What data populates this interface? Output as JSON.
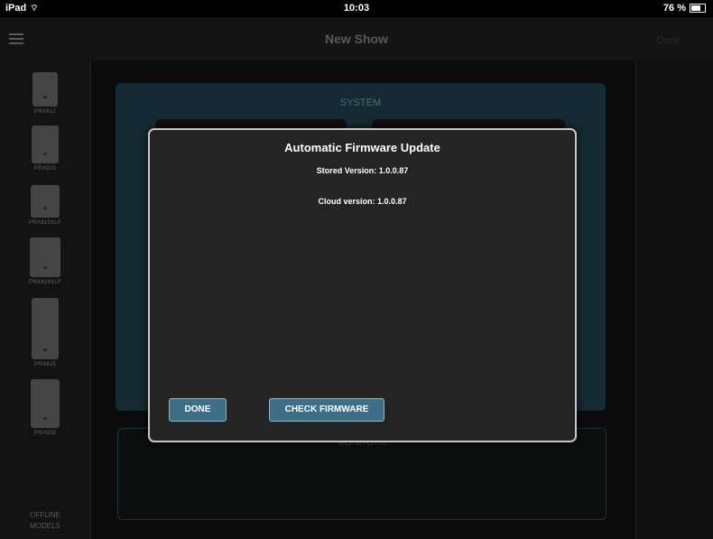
{
  "status_bar": {
    "device": "iPad",
    "time": "10:03",
    "battery": "76 %",
    "battery_level": 0.76
  },
  "nav": {
    "title": "New Show",
    "done_label": "Done"
  },
  "sidebar": {
    "speakers": [
      {
        "label": "PRX812"
      },
      {
        "label": "PRX815"
      },
      {
        "label": "PRX815XLF"
      },
      {
        "label": "PRX818XLF"
      },
      {
        "label": "PRX825"
      },
      {
        "label": "PRX835"
      }
    ],
    "offline_line1": "OFFLINE",
    "offline_line2": "MODELS"
  },
  "background": {
    "system_label": "SYSTEM",
    "monitors_label": "MONITORS"
  },
  "modal": {
    "title": "Automatic Firmware Update",
    "stored_version": "Stored Version:  1.0.0.87",
    "cloud_version": "Cloud version: 1.0.0.87",
    "done_button": "DONE",
    "check_button": "CHECK FIRMWARE"
  },
  "colors": {
    "accent": "#3e6f86",
    "panel": "#1d3a44",
    "modal_bg": "#242424"
  }
}
